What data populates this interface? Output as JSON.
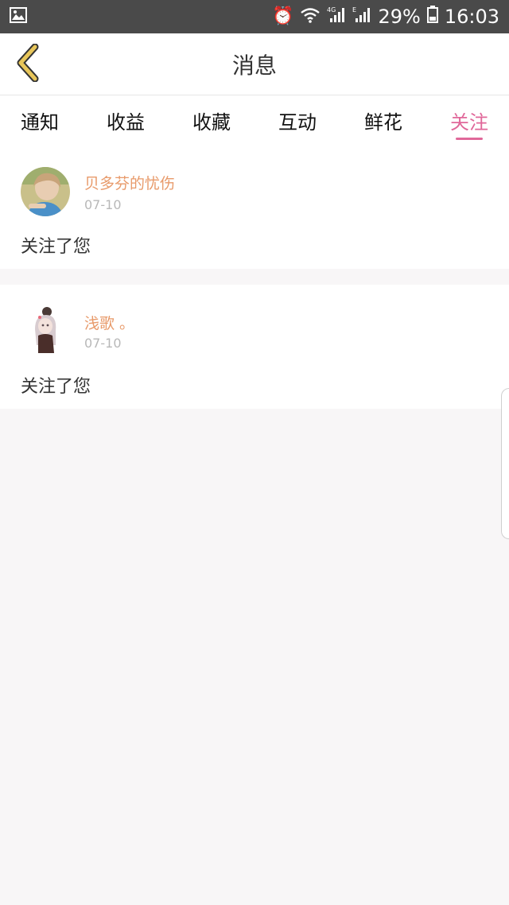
{
  "status_bar": {
    "battery": "29%",
    "time": "16:03",
    "icons": [
      "gallery-icon",
      "alarm-icon",
      "wifi-icon",
      "signal-4g-icon",
      "signal-e-icon",
      "battery-icon"
    ]
  },
  "header": {
    "title": "消息",
    "back_icon": "chevron-left-icon"
  },
  "tabs": [
    {
      "label": "通知",
      "active": false
    },
    {
      "label": "收益",
      "active": false
    },
    {
      "label": "收藏",
      "active": false
    },
    {
      "label": "互动",
      "active": false
    },
    {
      "label": "鲜花",
      "active": false
    },
    {
      "label": "关注",
      "active": true
    }
  ],
  "messages": [
    {
      "username": "贝多芬的忧伤",
      "date": "07-10",
      "text": "关注了您"
    },
    {
      "username": "浅歌 。",
      "date": "07-10",
      "text": "关注了您"
    }
  ],
  "colors": {
    "accent": "#e0689a",
    "username": "#e89a6a",
    "status_bar": "#4a4a4a",
    "back_icon": "#e8c65a"
  }
}
